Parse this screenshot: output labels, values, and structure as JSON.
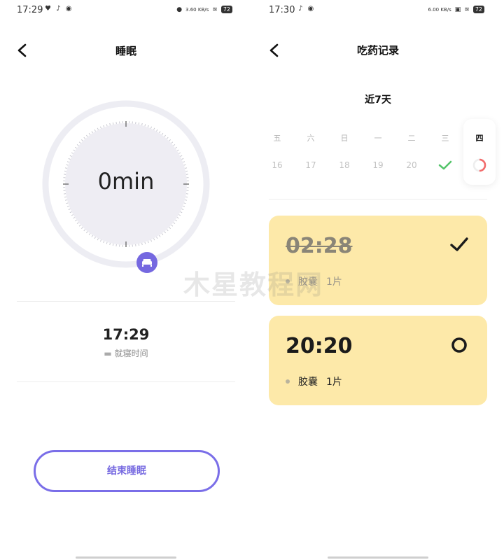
{
  "left": {
    "status": {
      "time": "17:29",
      "battery": "72",
      "net_speed": "3.60 KB/s"
    },
    "title": "睡眠",
    "timer": {
      "value": "0min"
    },
    "bedtime": {
      "time": "17:29",
      "label": "就寝时间"
    },
    "end_button": "结束睡眠"
  },
  "right": {
    "status": {
      "time": "17:30",
      "battery": "72",
      "net_speed": "6.00 KB/s"
    },
    "title": "吃药记录",
    "range_title": "近7天",
    "days": [
      {
        "weekday": "五",
        "date": "16",
        "state": "none"
      },
      {
        "weekday": "六",
        "date": "17",
        "state": "none"
      },
      {
        "weekday": "日",
        "date": "18",
        "state": "none"
      },
      {
        "weekday": "一",
        "date": "19",
        "state": "none"
      },
      {
        "weekday": "二",
        "date": "20",
        "state": "none"
      },
      {
        "weekday": "三",
        "date": "",
        "state": "done"
      },
      {
        "weekday": "四",
        "date": "",
        "state": "partial",
        "progress": 0.5
      }
    ],
    "medications": [
      {
        "time": "02:28",
        "name": "胶囊",
        "dose": "1片",
        "taken": true
      },
      {
        "time": "20:20",
        "name": "胶囊",
        "dose": "1片",
        "taken": false
      }
    ]
  },
  "watermark": "木星教程网",
  "colors": {
    "accent": "#7568e0",
    "card": "#fde9a9",
    "check": "#54c46a",
    "progress": "#f26b6b"
  }
}
